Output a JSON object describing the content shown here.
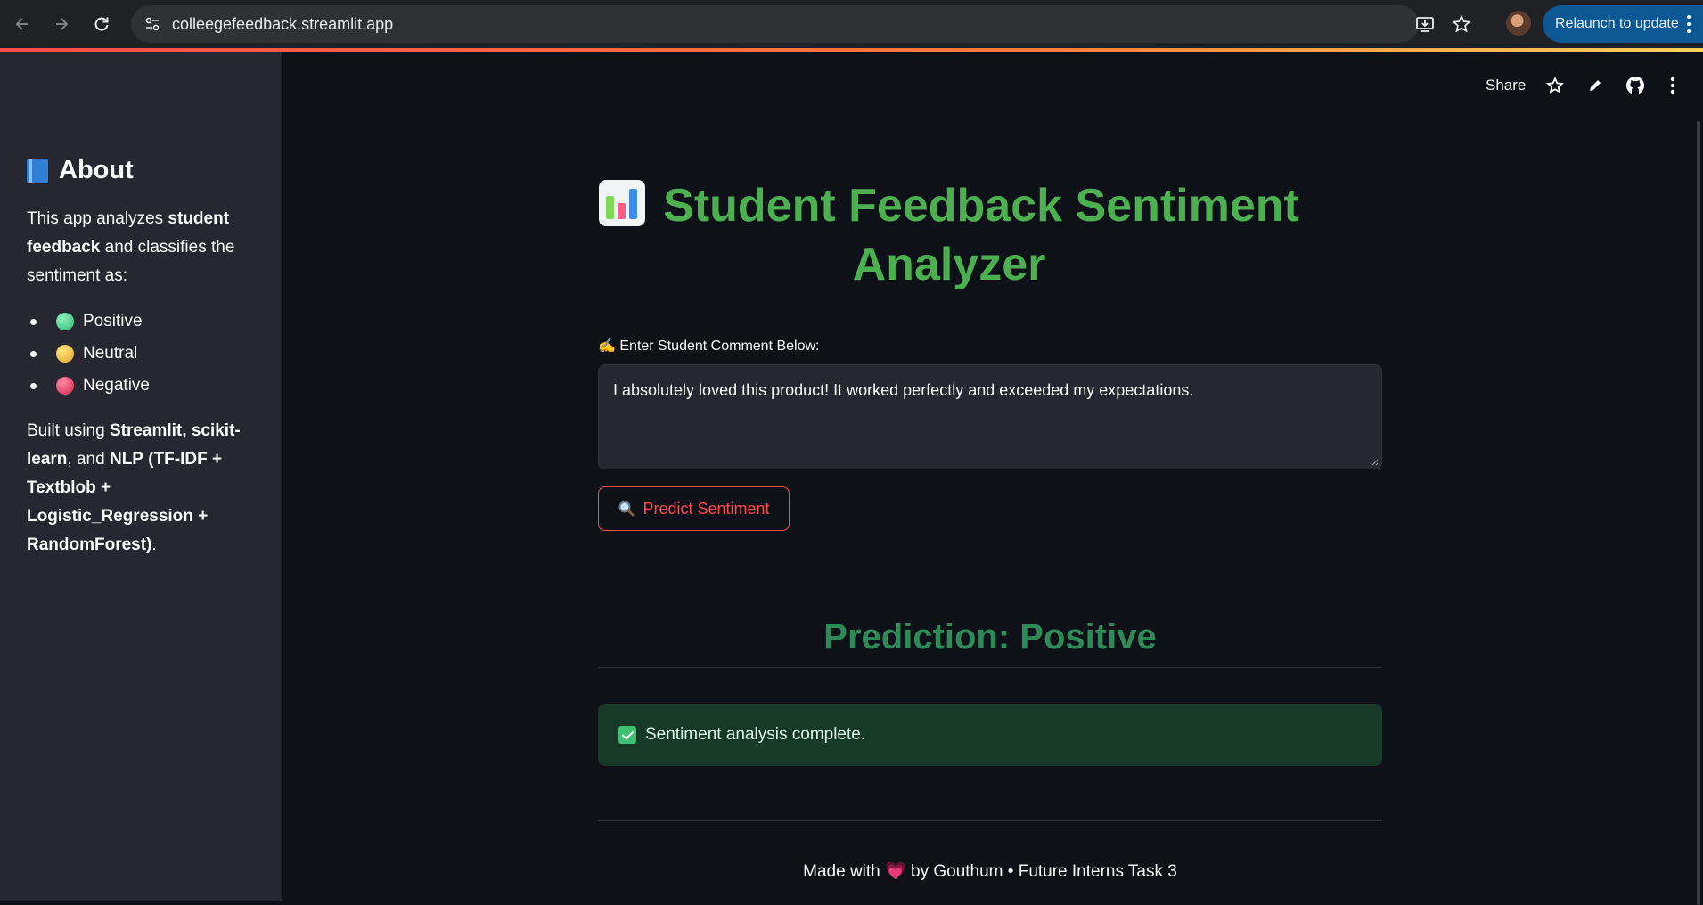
{
  "browser": {
    "url": "colleegefeedback.streamlit.app",
    "relaunch_label": "Relaunch to update"
  },
  "sidebar": {
    "title": "About",
    "intro": [
      "This app analyzes ",
      "student feedback",
      " and classifies the sentiment as:"
    ],
    "sentiments": [
      {
        "label": "Positive",
        "color": "#3ecf8e"
      },
      {
        "label": "Neutral",
        "color": "#f2c94c"
      },
      {
        "label": "Negative",
        "color": "#ef476f"
      }
    ],
    "built": [
      "Built using ",
      "Streamlit",
      ", ",
      "scikit-learn",
      ", and ",
      "NLP",
      " ",
      "(TF-IDF + Textblob + Logistic_Regression + RandomForest)",
      "."
    ]
  },
  "toolbar": {
    "share_label": "Share"
  },
  "main": {
    "title": "Student Feedback Sentiment Analyzer",
    "comment_label": "✍️ Enter Student Comment Below:",
    "comment_value": "I absolutely loved this product! It worked perfectly and exceeded my expectations.",
    "predict_label": "Predict Sentiment",
    "prediction": "Prediction: Positive",
    "success_message": "Sentiment analysis complete.",
    "footer": {
      "made_with": "Made with",
      "heart": "💗",
      "by_text": "by Gouthum • Future Interns Task 3"
    }
  },
  "colors": {
    "title_green": "#4caf50",
    "prediction_green": "#2e8b57",
    "accent_red": "#ff4b4b",
    "success_bg": "#173928"
  }
}
